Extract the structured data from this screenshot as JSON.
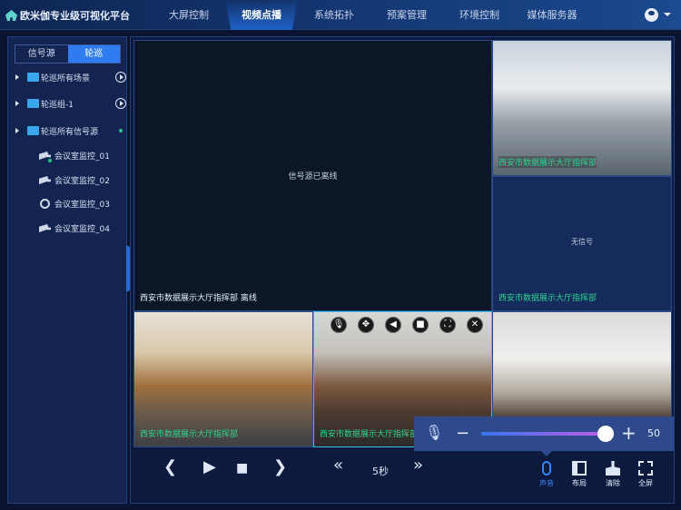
{
  "header": {
    "title": "欧米伽专业级可视化平台",
    "nav": [
      "大屏控制",
      "视频点播",
      "系统拓扑",
      "预案管理",
      "环境控制",
      "媒体服务器"
    ],
    "active_nav": "视频点播",
    "user_icon": "user-circle-icon"
  },
  "sidebar": {
    "tabs": [
      "信号源",
      "轮巡"
    ],
    "active_tab": "轮巡",
    "groups": [
      {
        "label": "轮巡所有场景",
        "action": "play-icon"
      },
      {
        "label": "轮巡组-1",
        "action": "play-icon"
      },
      {
        "label": "轮巡所有信号源",
        "status": "online"
      }
    ],
    "cameras": [
      {
        "label": "会议室监控_01",
        "icon": "camera-icon"
      },
      {
        "label": "会议室监控_02",
        "icon": "camera-icon"
      },
      {
        "label": "会议室监控_03",
        "icon": "webcam-icon"
      },
      {
        "label": "会议室监控_04",
        "icon": "camera-icon"
      }
    ]
  },
  "tiles": {
    "main": {
      "center": "信号源已离线",
      "caption": "西安市数据展示大厅指挥部  离线"
    },
    "top_right": {
      "caption": "西安市数据展示大厅指挥部"
    },
    "mid_right": {
      "center": "无信号",
      "caption": "西安市数据展示大厅指挥部"
    },
    "bottom_left": {
      "caption": "西安市数据展示大厅指挥部"
    },
    "bottom_mid": {
      "caption": "西安市数据展示大厅指挥部"
    }
  },
  "tile_controls": [
    "mic-icon",
    "move-icon",
    "speaker-icon",
    "camera-icon",
    "fullscreen-icon",
    "close-icon"
  ],
  "playback": {
    "interval": "5秒"
  },
  "volume": {
    "value": "50"
  },
  "tools": [
    {
      "label": "声音"
    },
    {
      "label": "布局"
    },
    {
      "label": "清除"
    },
    {
      "label": "全屏"
    }
  ],
  "colors": {
    "accent": "#2f7cf0",
    "caption": "#2fd38f"
  }
}
